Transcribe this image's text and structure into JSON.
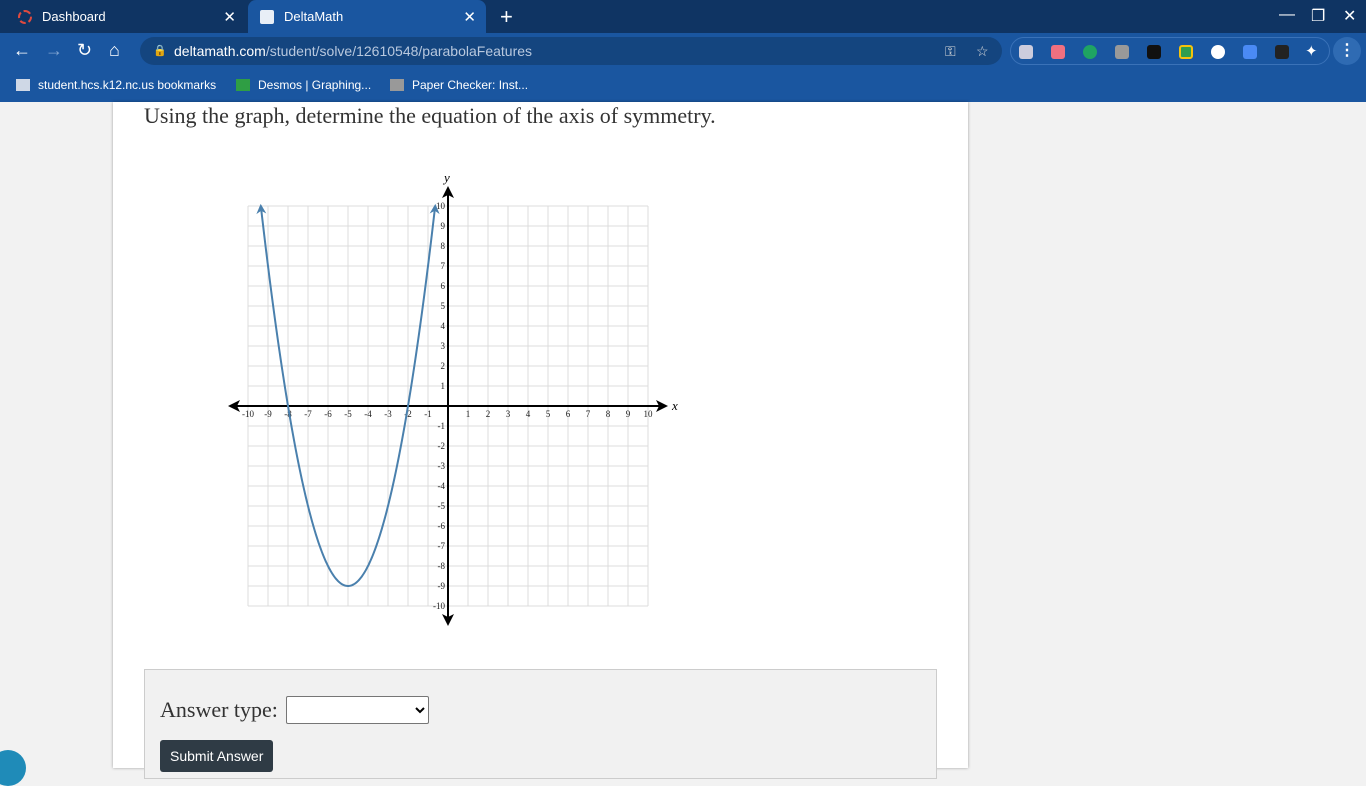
{
  "browser": {
    "tabs": [
      {
        "label": "Dashboard",
        "active": false
      },
      {
        "label": "DeltaMath",
        "active": true
      }
    ],
    "url_host": "deltamath.com",
    "url_path": "/student/solve/12610548/parabolaFeatures",
    "bookmarks": [
      "student.hcs.k12.nc.us bookmarks",
      "Desmos | Graphing...",
      "Paper Checker: Inst..."
    ]
  },
  "question": "Using the graph, determine the equation of the axis of symmetry.",
  "answer": {
    "label": "Answer type:",
    "select_value": "",
    "submit": "Submit Answer"
  },
  "chart_data": {
    "type": "line",
    "title": "",
    "xlabel": "x",
    "ylabel": "y",
    "xlim": [
      -10,
      10
    ],
    "ylim": [
      -10,
      10
    ],
    "grid": true,
    "xticks": [
      "-10",
      "-9",
      "-8",
      "-7",
      "-6",
      "-5",
      "-4",
      "-3",
      "-2",
      "-1",
      "1",
      "2",
      "3",
      "4",
      "5",
      "6",
      "7",
      "8",
      "9",
      "10"
    ],
    "yticks": [
      "10",
      "9",
      "8",
      "7",
      "6",
      "5",
      "4",
      "3",
      "2",
      "1",
      "-1",
      "-2",
      "-3",
      "-4",
      "-5",
      "-6",
      "-7",
      "-8",
      "-9",
      "-10"
    ],
    "series": [
      {
        "name": "parabola",
        "equation": "y=(x+5)^2-9",
        "vertex": [
          -5,
          -9
        ],
        "x_intercepts": [
          -8,
          -2
        ],
        "x_range": [
          -9.36,
          -0.64
        ],
        "color": "#4a80ad"
      }
    ]
  }
}
